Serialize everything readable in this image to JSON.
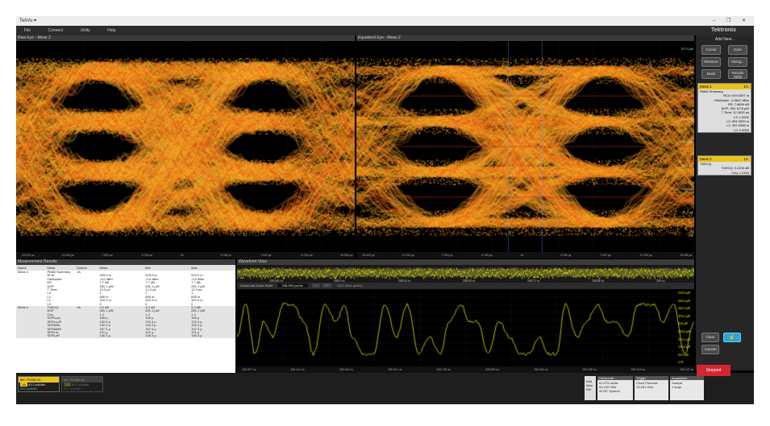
{
  "window": {
    "title": "TekVu ▾",
    "controls": "– ❐ ✕"
  },
  "menu": [
    "File",
    "Connect",
    "Utility",
    "Help"
  ],
  "brand": "Tektronix",
  "raw_eye": {
    "title": "Raw Eye - Meas 2",
    "x_ticks": [
      "-15.029 ps",
      "-11.294 ps",
      "-7.529 ps",
      "-3.765 ps",
      "0s",
      "3.765 ps",
      "7.529 ps",
      "11.294 ps",
      "15.059 ps"
    ]
  },
  "eq_eye": {
    "title": "Equalized Eye - Meas 2",
    "x_ticks": [
      "-15.029 ps",
      "-11.294 ps",
      "-7.529 ps",
      "-3.765 ps",
      "0s",
      "3.765 ps",
      "7.529 ps",
      "11.294 ps",
      "15.059 ps"
    ],
    "y_ticks": [
      "573.3 μW",
      "502 μW",
      "430.6 μW",
      "358.3 μW",
      "287.4 μW",
      "215.7 μW",
      "143.4 μW",
      "71.7 μW",
      "0 W"
    ]
  },
  "side": {
    "add_new": "Add New...",
    "buttons": [
      "Cursor",
      "Note",
      "Measure",
      "Histog...",
      "Mask",
      "Results Table"
    ],
    "meas1": {
      "title": "Meas 1",
      "badge": "1A",
      "lines": [
        "PAM4 Summary",
        "RLM: 929.0037 m",
        "OMAouter: -4.0647 dBm",
        "ER: 7.6694 dB",
        "AOP: 281.1178 μW",
        "T Time: 12.3030 ps",
        "L3: 1.0000",
        "L2: 654.9039 m",
        "L1: 322.3498 m",
        "L0: 0.0000"
      ]
    },
    "meas2": {
      "title": "Meas 2",
      "badge": "1A",
      "lines": [
        "TDECQ",
        "TDECQ: 3.2233 dB",
        "Ceq: 1.2164"
      ]
    },
    "clear": "Clear",
    "autoset": "Autoset"
  },
  "results": {
    "title": "Measurement Results",
    "columns": [
      "Name",
      "Meas",
      "Source",
      "Mean",
      "Min",
      "Max"
    ],
    "rows": [
      {
        "name": "Meas 1",
        "meas": "PAM4 Summary",
        "source": "1A",
        "mean": "",
        "min": "",
        "max": ""
      },
      {
        "name": "",
        "meas": "RLM",
        "source": "",
        "mean": "929.0 m",
        "min": "929.0 m",
        "max": "929.0 m"
      },
      {
        "name": "",
        "meas": "OMAouter",
        "source": "",
        "mean": "-4.0 dBm",
        "min": "-4.0 dBm",
        "max": "-4.0 dBm"
      },
      {
        "name": "",
        "meas": "ER",
        "source": "",
        "mean": "7.7 dB",
        "min": "7.7 dB",
        "max": "7.7 dB"
      },
      {
        "name": "",
        "meas": "AOP",
        "source": "",
        "mean": "281.1 μW",
        "min": "281.1 μW",
        "max": "281.1 μW"
      },
      {
        "name": "",
        "meas": "T Time",
        "source": "",
        "mean": "12.3 ps",
        "min": "12.3 ps",
        "max": "12.3 ps"
      },
      {
        "name": "",
        "meas": "L3",
        "source": "",
        "mean": "1",
        "min": "1",
        "max": "1"
      },
      {
        "name": "",
        "meas": "L2",
        "source": "",
        "mean": "655 m",
        "min": "655 m",
        "max": "655 m"
      },
      {
        "name": "",
        "meas": "L1",
        "source": "",
        "mean": "322.3 m",
        "min": "322.3 m",
        "max": "322.3 m"
      },
      {
        "name": "",
        "meas": "L0",
        "source": "",
        "mean": "0",
        "min": "0",
        "max": "0"
      },
      {
        "name": "Meas 2",
        "meas": "TDECQ",
        "source": "1A",
        "mean": "3.2 dB",
        "min": "3.2 dB",
        "max": "3.2 dB"
      },
      {
        "name": "",
        "meas": "AOP",
        "source": "",
        "mean": "281.1 μW",
        "min": "281.1 μW",
        "max": "281.1 μW"
      },
      {
        "name": "",
        "meas": "Ceq",
        "source": "",
        "mean": "1.2",
        "min": "1.2",
        "max": "1.2"
      },
      {
        "name": "",
        "meas": "SERLLpL",
        "source": "",
        "mean": "165 μ",
        "min": "165 μ",
        "max": "165 μ"
      },
      {
        "name": "",
        "meas": "SERLLpR",
        "source": "",
        "mean": "132.4 μ",
        "min": "132.4 μ",
        "max": "132.4 μ"
      },
      {
        "name": "",
        "meas": "SERMidL",
        "source": "",
        "mean": "192.3 μ",
        "min": "192.3 μ",
        "max": "192.3 μ"
      },
      {
        "name": "",
        "meas": "SERMidR",
        "source": "",
        "mean": "157.4 μ",
        "min": "157.4 μ",
        "max": "157.4 μ"
      },
      {
        "name": "",
        "meas": "SERLoL",
        "source": "",
        "mean": "121 μ",
        "min": "121 μ",
        "max": "121 μ"
      },
      {
        "name": "",
        "meas": "SERLoR",
        "source": "",
        "mean": "106.3 μ",
        "min": "106.3 μ",
        "max": "106.3 μ"
      }
    ]
  },
  "waveform": {
    "title": "Waveform View",
    "zoom_label": "Horizontal Zoom Scale",
    "zoom_value": "208.553 ps/div",
    "zoom_pos": "1000 (Max points)",
    "overview_ticks": [
      "208.001 ns",
      "208.3 ns",
      "208.44 ns",
      "208.58 ns",
      "208.72 ns",
      "208.86 ns",
      "209 ns"
    ],
    "x_ticks": [
      "208.307 ns",
      "208.412 ns",
      "208.516 ns",
      "208.621 ns",
      "208.725 ns",
      "208.829 ns",
      "208.934 ns",
      "209.038 ns",
      "209.143 ns",
      "209.247 ns"
    ],
    "y_ticks": [
      "559.8 μW",
      "503.4 μW",
      "442.4 μW",
      "376.2 μW",
      "310 μW",
      "253.6 μW",
      "191.5 μW",
      "126.8 μW",
      "63.2 μW",
      "0 W"
    ]
  },
  "bottom": {
    "ch1": {
      "title": "M1: TSO8C16",
      "badge": "1A",
      "line1": "63.2 μW/div",
      "line2": "20.0 μW/div"
    },
    "ch2": {
      "title": "M2: TSO8C16",
      "badge": "1A",
      "line1": "63.2 μW/div",
      "line2": "20.0 μW/div"
    },
    "add_new": "Add New Ref",
    "horizontal": {
      "title": "Horizontal",
      "lines": [
        "61.679 ns/div",
        "53.125 GBd",
        "32767 Symbol"
      ]
    },
    "trigger": {
      "title": "Trigger",
      "lines": [
        "Clock Prescale",
        "13.281 GHz"
      ]
    },
    "acquisition": {
      "title": "Acquisition",
      "lines": [
        "Sample",
        "1 Acqs"
      ]
    },
    "stopped": "Stopped"
  },
  "colors": {
    "trace": "#f0b020",
    "trace_hot": "#e84a10",
    "wave": "#e6e600",
    "accent": "#e8c21c",
    "stop": "#d42630"
  }
}
